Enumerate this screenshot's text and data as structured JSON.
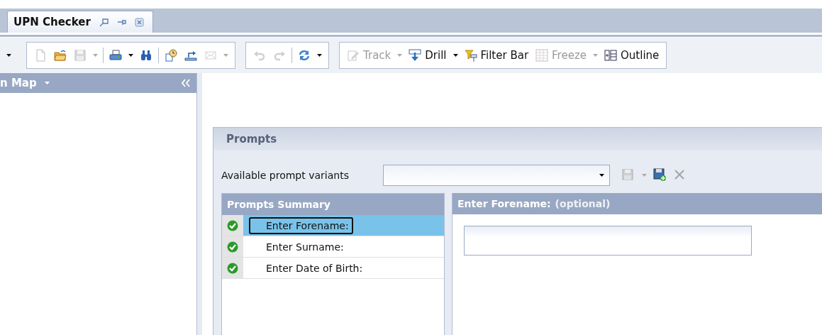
{
  "tab": {
    "title": "UPN Checker",
    "selected": true
  },
  "toolbar": {
    "groups": [
      {
        "items": [
          {
            "kind": "arrow",
            "disabled": false
          }
        ]
      },
      {
        "items": [
          {
            "kind": "button",
            "disabled": true
          },
          {
            "kind": "button",
            "disabled": false
          },
          {
            "kind": "button",
            "disabled": true,
            "dropdown": true
          },
          {
            "kind": "separator"
          },
          {
            "kind": "button",
            "disabled": false,
            "dropdown": true
          },
          {
            "kind": "button",
            "disabled": false
          },
          {
            "kind": "separator"
          },
          {
            "kind": "button",
            "disabled": false
          },
          {
            "kind": "button",
            "disabled": false
          },
          {
            "kind": "button",
            "disabled": true,
            "dropdown": true
          }
        ]
      },
      {
        "items": [
          {
            "kind": "button",
            "disabled": true
          },
          {
            "kind": "button",
            "disabled": true
          },
          {
            "kind": "separator"
          },
          {
            "kind": "button",
            "disabled": false,
            "dropdown": true
          }
        ]
      },
      {
        "items": [
          {
            "kind": "button",
            "label": "Track",
            "disabled": true,
            "dropdown": true
          },
          {
            "kind": "button",
            "label": "Drill",
            "disabled": false,
            "dropdown": true
          },
          {
            "kind": "button",
            "label": "Filter Bar",
            "disabled": false,
            "dropdown": false
          },
          {
            "kind": "button",
            "label": "Freeze",
            "disabled": true,
            "dropdown": true
          },
          {
            "kind": "button",
            "label": "Outline",
            "disabled": false,
            "dropdown": false
          }
        ]
      }
    ]
  },
  "side_panel": {
    "title": "n Map"
  },
  "prompts": {
    "title": "Prompts",
    "variants_label": "Available prompt variants",
    "variant_actions": [
      {
        "disabled": true,
        "dropdown": true
      },
      {
        "disabled": false
      },
      {
        "disabled": true
      }
    ],
    "summary": {
      "title": "Prompts Summary",
      "rows": [
        {
          "label": "Enter Forename:",
          "done": true,
          "selected": true
        },
        {
          "label": "Enter Surname:",
          "done": true,
          "selected": false
        },
        {
          "label": "Enter Date of Birth:",
          "done": true,
          "selected": false
        }
      ]
    },
    "detail": {
      "title": "Enter Forename:",
      "note": "(optional)"
    }
  }
}
